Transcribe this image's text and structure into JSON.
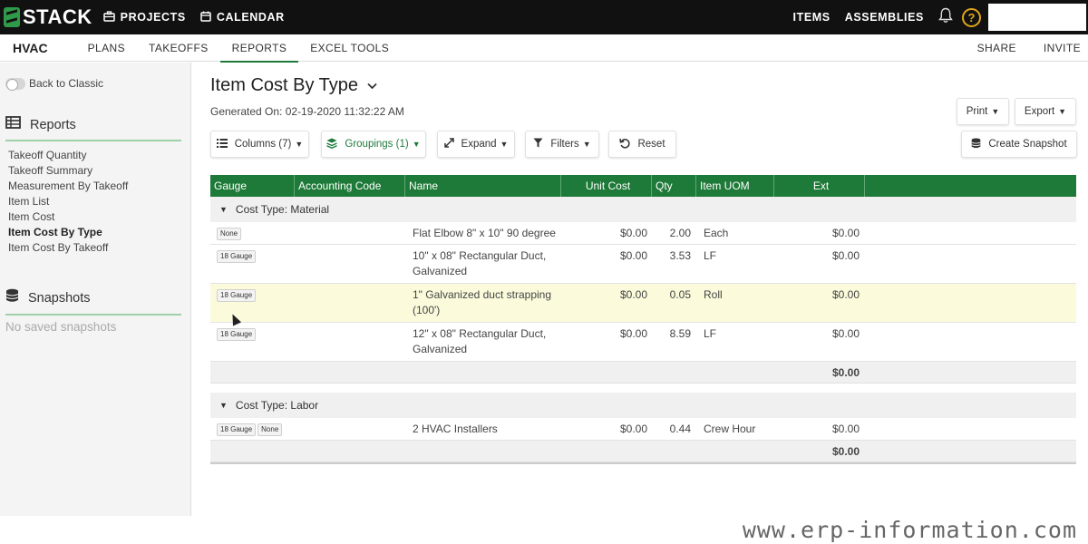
{
  "topbar": {
    "logo": "STACK",
    "nav": [
      {
        "label": "PROJECTS",
        "icon": "briefcase-icon"
      },
      {
        "label": "CALENDAR",
        "icon": "calendar-icon"
      }
    ],
    "right_links": [
      "ITEMS",
      "ASSEMBLIES"
    ],
    "help": "?"
  },
  "subnav": {
    "project": "HVAC",
    "tabs": [
      "PLANS",
      "TAKEOFFS",
      "REPORTS",
      "EXCEL TOOLS"
    ],
    "active_tab": "REPORTS",
    "right": [
      "SHARE",
      "INVITE"
    ]
  },
  "sidebar": {
    "toggle_label": "Back to Classic",
    "reports_heading": "Reports",
    "reports": [
      "Takeoff Quantity",
      "Takeoff Summary",
      "Measurement By Takeoff",
      "Item List",
      "Item Cost",
      "Item Cost By Type",
      "Item Cost By Takeoff"
    ],
    "active_report": "Item Cost By Type",
    "snapshots_heading": "Snapshots",
    "snapshots_empty": "No saved snapshots"
  },
  "main": {
    "title": "Item Cost By Type",
    "generated": "Generated On: 02-19-2020 11:32:22 AM",
    "toolbar": {
      "columns": "Columns (7)",
      "groupings": "Groupings (1)",
      "expand": "Expand",
      "filters": "Filters",
      "reset": "Reset",
      "print": "Print",
      "export": "Export",
      "snapshot": "Create Snapshot"
    },
    "table": {
      "headers": [
        "Gauge",
        "Accounting Code",
        "Name",
        "Unit Cost",
        "Qty",
        "Item UOM",
        "Ext"
      ],
      "groups": [
        {
          "label": "Cost Type: Material",
          "rows": [
            {
              "badges": [
                "None"
              ],
              "name1": "Flat Elbow 8\" x 10\" 90 degree",
              "name2": "",
              "unit_cost": "$0.00",
              "qty": "2.00",
              "uom": "Each",
              "ext": "$0.00"
            },
            {
              "badges": [
                "18 Gauge"
              ],
              "name1": "10\" x 08\" Rectangular Duct,",
              "name2": "Galvanized",
              "unit_cost": "$0.00",
              "qty": "3.53",
              "uom": "LF",
              "ext": "$0.00"
            },
            {
              "badges": [
                "18 Gauge"
              ],
              "name1": "1\" Galvanized duct strapping",
              "name2": "(100')",
              "unit_cost": "$0.00",
              "qty": "0.05",
              "uom": "Roll",
              "ext": "$0.00"
            },
            {
              "badges": [
                "18 Gauge"
              ],
              "name1": "12\" x 08\" Rectangular Duct,",
              "name2": "Galvanized",
              "unit_cost": "$0.00",
              "qty": "8.59",
              "uom": "LF",
              "ext": "$0.00"
            }
          ],
          "subtotal": "$0.00"
        },
        {
          "label": "Cost Type: Labor",
          "rows": [
            {
              "badges": [
                "18 Gauge",
                "None"
              ],
              "name1": "2 HVAC Installers",
              "name2": "",
              "unit_cost": "$0.00",
              "qty": "0.44",
              "uom": "Crew Hour",
              "ext": "$0.00"
            }
          ],
          "subtotal": "$0.00"
        }
      ]
    }
  },
  "watermark": "www.erp-information.com"
}
